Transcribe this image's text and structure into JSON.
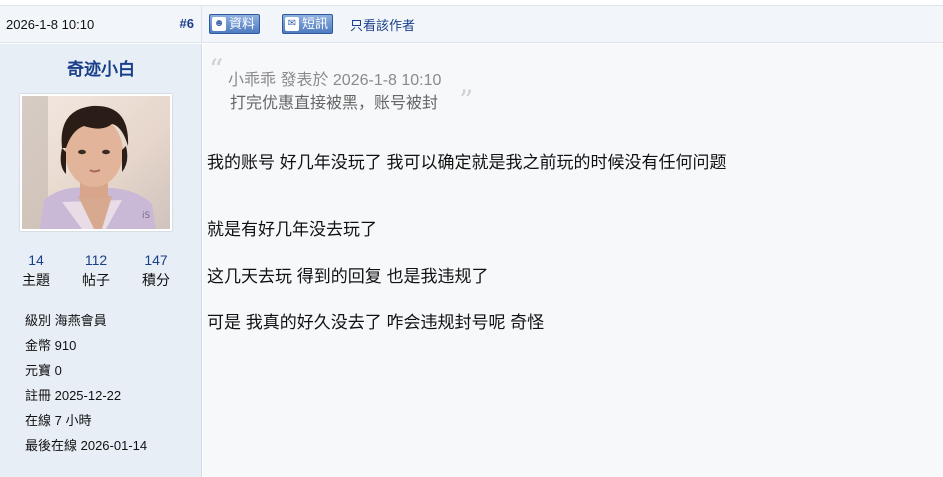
{
  "post": {
    "time": "2026-1-8 10:10",
    "number": "#6",
    "profile_button": "資料",
    "pm_button": "短訊",
    "only_author": "只看該作者"
  },
  "user": {
    "name": "奇迹小白",
    "stats": [
      {
        "value": "14",
        "label": "主題"
      },
      {
        "value": "112",
        "label": "帖子"
      },
      {
        "value": "147",
        "label": "積分"
      }
    ],
    "info": [
      "級別 海燕會員",
      "金幣 910",
      "元寶 0",
      "註冊 2025-12-22",
      "在線 7 小時",
      "最後在線 2026-01-14"
    ]
  },
  "quote": {
    "meta": "小乖乖 發表於 2026-1-8 10:10",
    "text": "打完优惠直接被黑，账号被封"
  },
  "body": {
    "lines": [
      "我的账号 好几年没玩了 我可以确定就是我之前玩的时候没有任何问题",
      "就是有好几年没去玩了",
      "这几天去玩 得到的回复 也是我违规了",
      "可是 我真的好久没去了 咋会违规封号呢 奇怪"
    ]
  },
  "colors": {
    "link": "#1a3f8a",
    "sidebar_bg": "#e7eef6",
    "content_bg": "#f7f8fa",
    "header_bg": "#f2f6fa"
  }
}
